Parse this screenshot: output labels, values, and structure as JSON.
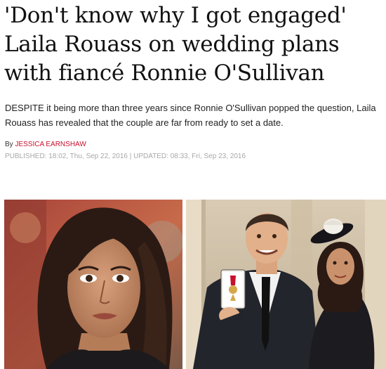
{
  "headline": {
    "line1": "'Don't know why I got engaged'",
    "line2": "Laila Rouass on wedding plans",
    "line3": "with fiancé Ronnie O'Sullivan"
  },
  "standfirst": "DESPITE it being more than three years since Ronnie O'Sullivan popped the question, Laila Rouass has revealed that the couple are far from ready to set a date.",
  "byline": {
    "prefix": "By",
    "author": "JESSICA EARNSHAW"
  },
  "dateline": {
    "published_label": "PUBLISHED:",
    "published": "18:02, Thu, Sep 22, 2016",
    "separator": "|",
    "updated_label": "UPDATED:",
    "updated": "08:33, Fri, Sep 23, 2016"
  },
  "colors": {
    "author_link": "#c8102e",
    "dateline": "#a8a8a8"
  }
}
